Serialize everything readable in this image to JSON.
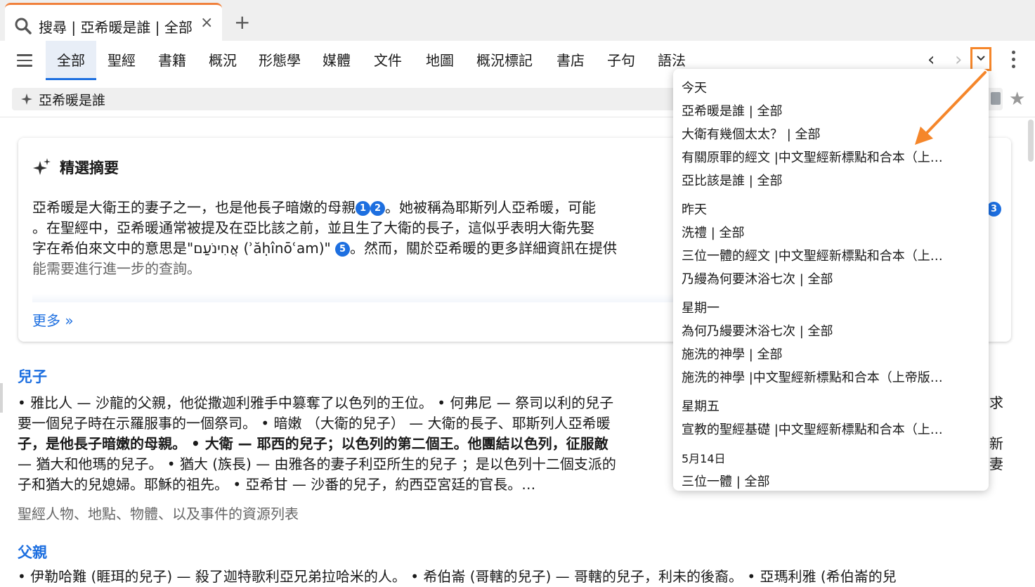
{
  "tab": {
    "title": "搜尋 | 亞希暖是誰 | 全部",
    "close": "×",
    "new_tab": "+"
  },
  "nav": {
    "tabs": [
      "全部",
      "聖經",
      "書籍",
      "概況",
      "形態學",
      "媒體",
      "文件",
      "地圖",
      "概況標記",
      "書店",
      "子句",
      "語法"
    ],
    "active_index": 0,
    "prev": "‹",
    "next": "›"
  },
  "search": {
    "query": "亞希暖是誰"
  },
  "summary": {
    "title": "精選摘要",
    "line1a": "亞希暖是大衛王的妻子之一，也是他長子暗嫩的母親",
    "line1b": "。她被稱為耶斯列人亞希暖，可能",
    "line2": "。在聖經中，亞希暖通常被提及在亞比該之前，並且生了大衛的長子，這似乎表明大衛先娶",
    "line3a": "字在希伯來文中的意思是\"אֲחִינֹעַם (ʾăḥînōʿam)\"",
    "line3b": "。然而，關於亞希暖的更多詳細資訊在提供",
    "line4": "能需要進行進一步的查詢。",
    "cites": [
      "1",
      "2",
      "5",
      "3"
    ],
    "more": "更多 »"
  },
  "results": [
    {
      "title": "兒子",
      "lines": [
        "• 雅比人 — 沙龍的父親，他從撒迦利雅手中篡奪了以色列的王位。 • 何弗尼 — 祭司以利的兒子",
        "要一個兒子時在示羅服事的一個祭司。 • 暗嫩 （大衛的兒子） — 大衛的長子、耶斯列人亞希暖",
        "子，是他長子暗嫩的母親。 • 大衛 — 耶西的兒子；以色列的第二個王。他團結以色列，征服敵",
        "— 猶大和他瑪的兒子。 • 猶大 (族長) — 由雅各的妻子利亞所生的兒子 ；是以色列十二個支派的",
        "子和猶大的兒媳婦。耶穌的祖先。 • 亞希甘 — 沙番的兒子，約西亞宮廷的官長。…"
      ],
      "right_fragments": [
        "求",
        "新",
        "妻"
      ],
      "source": "聖經人物、地點、物體、以及事件的資源列表"
    },
    {
      "title": "父親",
      "lines": [
        "• 伊勒哈難 (睚珥的兒子) — 殺了迦特歌利亞兄弟拉哈米的人。 • 希伯崙 (哥轄的兒子) — 哥轄的兒子，利未的後裔。 • 亞瑪利雅 (希伯崙的兒"
      ]
    }
  ],
  "history": [
    {
      "type": "head",
      "text": "今天"
    },
    {
      "type": "item",
      "text": "亞希暖是誰 | 全部"
    },
    {
      "type": "item",
      "text": "大衛有幾個太太？ | 全部"
    },
    {
      "type": "item",
      "text": "有關原罪的經文 |中文聖經新標點和合本（上…"
    },
    {
      "type": "item",
      "text": "亞比該是誰 | 全部"
    },
    {
      "type": "head",
      "text": "昨天"
    },
    {
      "type": "item",
      "text": "洗禮 | 全部"
    },
    {
      "type": "item",
      "text": "三位一體的經文 |中文聖經新標點和合本（上…"
    },
    {
      "type": "item",
      "text": "乃縵為何要沐浴七次 | 全部"
    },
    {
      "type": "head",
      "text": "星期一"
    },
    {
      "type": "item",
      "text": "為何乃縵要沐浴七次 | 全部"
    },
    {
      "type": "item",
      "text": "施洗的神學 | 全部"
    },
    {
      "type": "item",
      "text": "施洗的神學 |中文聖經新標點和合本（上帝版…"
    },
    {
      "type": "head",
      "text": "星期五"
    },
    {
      "type": "item",
      "text": "宣教的聖經基礎 |中文聖經新標點和合本（上…"
    },
    {
      "type": "head",
      "text": "5月14日"
    },
    {
      "type": "item",
      "text": "三位一體 | 全部"
    }
  ],
  "colors": {
    "accent": "#1d6fe0",
    "highlight": "#f5862a",
    "tab_indicator": "#f0803c"
  }
}
